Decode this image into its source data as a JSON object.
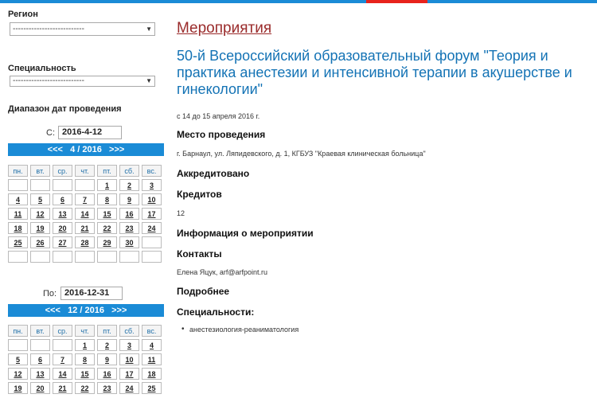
{
  "colors": {
    "accent": "#1a8bd6",
    "topbar_red": "#e8231c",
    "title_link": "#9a2b2b",
    "event_title": "#1473b5"
  },
  "sidebar": {
    "region_label": "Регион",
    "region_select": "---------------------------",
    "specialty_label": "Специальность",
    "specialty_select": "---------------------------",
    "date_range_label": "Диапазон дат проведения",
    "from": {
      "label": "С:",
      "value": "2016-4-12"
    },
    "to": {
      "label": "По:",
      "value": "2016-12-31"
    },
    "cal1": {
      "prev": "<<<",
      "month": "4 / 2016",
      "next": ">>>",
      "weekdays": [
        "пн.",
        "вт.",
        "ср.",
        "чт.",
        "пт.",
        "сб.",
        "вс."
      ],
      "weeks": [
        [
          "",
          "",
          "",
          "",
          "1",
          "2",
          "3"
        ],
        [
          "4",
          "5",
          "6",
          "7",
          "8",
          "9",
          "10"
        ],
        [
          "11",
          "12",
          "13",
          "14",
          "15",
          "16",
          "17"
        ],
        [
          "18",
          "19",
          "20",
          "21",
          "22",
          "23",
          "24"
        ],
        [
          "25",
          "26",
          "27",
          "28",
          "29",
          "30",
          ""
        ],
        [
          "",
          "",
          "",
          "",
          "",
          "",
          ""
        ]
      ]
    },
    "cal2": {
      "prev": "<<<",
      "month": "12 / 2016",
      "next": ">>>",
      "weekdays": [
        "пн.",
        "вт.",
        "ср.",
        "чт.",
        "пт.",
        "сб.",
        "вс."
      ],
      "weeks": [
        [
          "",
          "",
          "",
          "1",
          "2",
          "3",
          "4"
        ],
        [
          "5",
          "6",
          "7",
          "8",
          "9",
          "10",
          "11"
        ],
        [
          "12",
          "13",
          "14",
          "15",
          "16",
          "17",
          "18"
        ],
        [
          "19",
          "20",
          "21",
          "22",
          "23",
          "24",
          "25"
        ]
      ]
    }
  },
  "main": {
    "section_title": "Мероприятия",
    "event_title": "50-й Всероссийский образовательный форум \"Теория и практика анестезии и интенсивной терапии в акушерстве и гинекологии\"",
    "dates": "с 14 до 15 апреля 2016 г.",
    "venue_label": "Место проведения",
    "venue": "г. Барнаул, ул. Ляпидевского, д. 1, КГБУЗ \"Краевая клиническая больница\"",
    "accredited_label": "Аккредитовано",
    "credits_label": "Кредитов",
    "credits": "12",
    "info_label": "Информация о мероприятии",
    "contacts_label": "Контакты",
    "contacts": "Елена Яцук, arf@arfpoint.ru",
    "more_label": "Подробнее",
    "specialties_label": "Специальности:",
    "specialties": [
      "анестезиология-реаниматология"
    ]
  }
}
